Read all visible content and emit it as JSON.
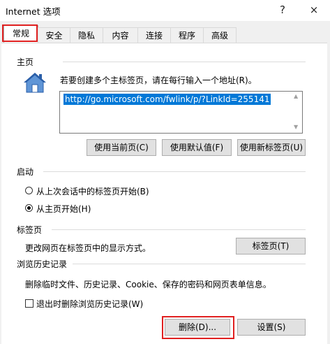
{
  "window": {
    "title": "Internet 选项",
    "help_label": "?",
    "close_label": "×"
  },
  "tabs": [
    {
      "label": "常规"
    },
    {
      "label": "安全"
    },
    {
      "label": "隐私"
    },
    {
      "label": "内容"
    },
    {
      "label": "连接"
    },
    {
      "label": "程序"
    },
    {
      "label": "高级"
    }
  ],
  "homepage": {
    "heading": "主页",
    "description": "若要创建多个主标签页，请在每行输入一个地址(R)。",
    "url_value": "http://go.microsoft.com/fwlink/p/?LinkId=255141",
    "use_current_label": "使用当前页(C)",
    "use_default_label": "使用默认值(F)",
    "use_new_tab_label": "使用新标签页(U)"
  },
  "startup": {
    "heading": "启动",
    "option_last_session": "从上次会话中的标签页开始(B)",
    "option_homepage": "从主页开始(H)",
    "selected": "option_homepage"
  },
  "tabs_section": {
    "heading": "标签页",
    "description": "更改网页在标签页中的显示方式。",
    "button_label": "标签页(T)"
  },
  "history": {
    "heading": "浏览历史记录",
    "description": "删除临时文件、历史记录、Cookie、保存的密码和网页表单信息。",
    "checkbox_label": "退出时删除浏览历史记录(W)",
    "checkbox_checked": false,
    "delete_label": "删除(D)...",
    "settings_label": "设置(S)"
  },
  "colors": {
    "highlight_red": "#e02020",
    "selection_blue": "#0078d7"
  }
}
